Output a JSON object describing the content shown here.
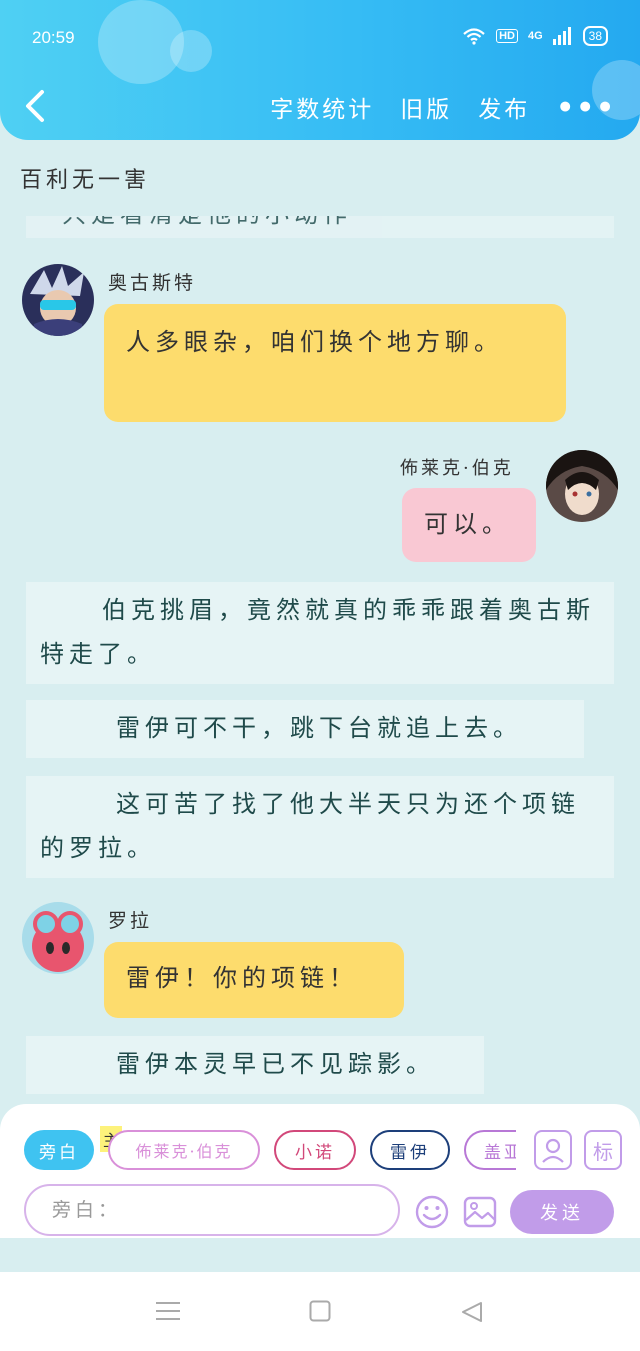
{
  "status": {
    "time": "20:59",
    "hd": "HD",
    "network": "4G",
    "battery": "38"
  },
  "nav": {
    "back_icon": "chevron-left-icon",
    "word_count": "字数统计",
    "old_version": "旧版",
    "publish": "发布",
    "more": "•••"
  },
  "doc": {
    "title": "百利无一害"
  },
  "feed": {
    "clipped_text": "只是看清楚他的小动作",
    "items": [
      {
        "type": "message",
        "speaker": "奥古斯特",
        "text": "人多眼杂，咱们换个地方聊。",
        "color": "#fddc6d",
        "side": "left"
      },
      {
        "type": "message",
        "speaker": "佈莱克·伯克",
        "text": "可以。",
        "color": "#f9c8d3",
        "side": "right"
      },
      {
        "type": "narration",
        "text": "伯克挑眉，竟然就真的乖乖跟着奥古斯特走了。"
      },
      {
        "type": "narration",
        "text": "雷伊可不干，跳下台就追上去。"
      },
      {
        "type": "narration",
        "text": "这可苦了找了他大半天只为还个项链的罗拉。"
      },
      {
        "type": "message",
        "speaker": "罗拉",
        "text": "雷伊！你的项链！",
        "color": "#fddc6d",
        "side": "left"
      },
      {
        "type": "narration",
        "text": "雷伊本灵早已不见踪影。"
      }
    ]
  },
  "composer": {
    "main_tag": "主",
    "chips": [
      {
        "label": "旁白",
        "color": "#3fc3f1",
        "active": true
      },
      {
        "label": "佈莱克·伯克",
        "color": "#d990d9",
        "active": false
      },
      {
        "label": "小诺",
        "color": "#d2487a",
        "active": false
      },
      {
        "label": "雷伊",
        "color": "#1d3f7a",
        "active": false
      },
      {
        "label": "盖亚",
        "color": "#b878d6",
        "active": false
      }
    ],
    "contacts_icon": "contact-card-icon",
    "tag_label": "标",
    "input_placeholder": "旁白：",
    "emoji_icon": "smiley-icon",
    "image_icon": "image-icon",
    "send_label": "发送"
  },
  "system_nav": {
    "menu_icon": "menu-lines-icon",
    "home_icon": "square-home-icon",
    "back_icon": "triangle-back-icon"
  }
}
